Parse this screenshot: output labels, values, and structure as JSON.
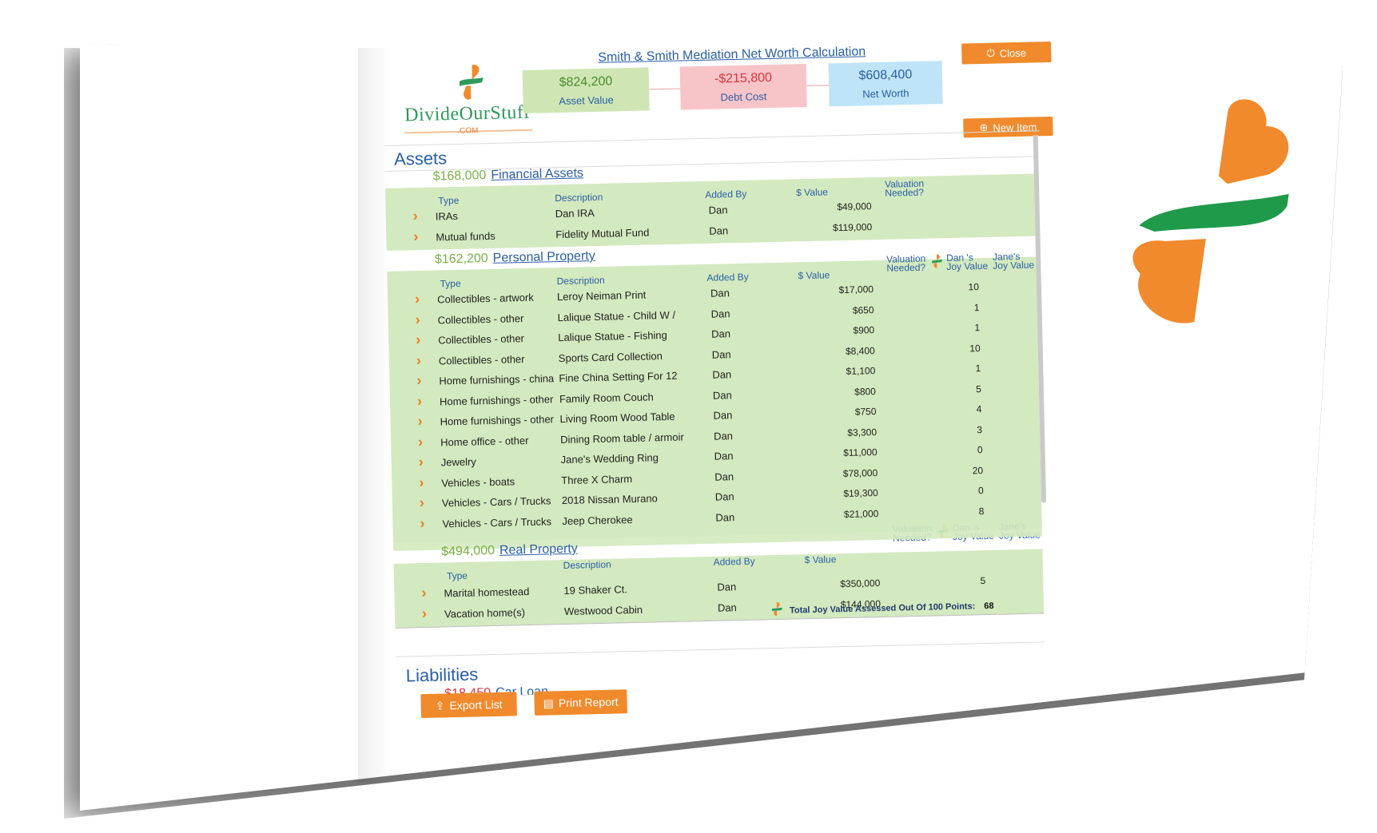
{
  "header": {
    "title": "Smith & Smith Mediation Net Worth Calculation",
    "close_label": "Close",
    "new_item_label": "New Item",
    "logo_text": "DivideOurStuff",
    "logo_com": ".COM"
  },
  "summary": {
    "asset_value": "$824,200",
    "asset_label": "Asset Value",
    "debt_cost": "-$215,800",
    "debt_label": "Debt Cost",
    "net_worth": "$608,400",
    "net_label": "Net Worth"
  },
  "assets": {
    "title": "Assets",
    "financial": {
      "amount": "$168,000",
      "name": "Financial Assets",
      "cols": {
        "type": "Type",
        "description": "Description",
        "added_by": "Added By",
        "value": "$ Value",
        "valuation": "Valuation Needed?"
      },
      "rows": [
        {
          "type": "IRAs",
          "description": "Dan IRA",
          "added_by": "Dan",
          "value": "$49,000"
        },
        {
          "type": "Mutual funds",
          "description": "Fidelity Mutual Fund",
          "added_by": "Dan",
          "value": "$119,000"
        }
      ]
    },
    "personal": {
      "amount": "$162,200",
      "name": "Personal Property",
      "cols": {
        "type": "Type",
        "description": "Description",
        "added_by": "Added By",
        "value": "$ Value",
        "valuation": "Valuation Needed?",
        "dan_joy": "Dan 's Joy Value",
        "jane_joy": "Jane's Joy Value"
      },
      "rows": [
        {
          "type": "Collectibles - artwork",
          "description": "Leroy Neiman Print",
          "added_by": "Dan",
          "value": "$17,000",
          "joy": "10"
        },
        {
          "type": "Collectibles - other",
          "description": "Lalique Statue - Child W /",
          "added_by": "Dan",
          "value": "$650",
          "joy": "1"
        },
        {
          "type": "Collectibles - other",
          "description": "Lalique Statue - Fishing",
          "added_by": "Dan",
          "value": "$900",
          "joy": "1"
        },
        {
          "type": "Collectibles - other",
          "description": "Sports Card Collection",
          "added_by": "Dan",
          "value": "$8,400",
          "joy": "10"
        },
        {
          "type": "Home furnishings - china",
          "description": "Fine China Setting For 12",
          "added_by": "Dan",
          "value": "$1,100",
          "joy": "1"
        },
        {
          "type": "Home furnishings - other",
          "description": "Family Room Couch",
          "added_by": "Dan",
          "value": "$800",
          "joy": "5"
        },
        {
          "type": "Home furnishings - other",
          "description": "Living Room Wood Table",
          "added_by": "Dan",
          "value": "$750",
          "joy": "4"
        },
        {
          "type": "Home office - other",
          "description": "Dining Room table / armoir",
          "added_by": "Dan",
          "value": "$3,300",
          "joy": "3"
        },
        {
          "type": "Jewelry",
          "description": "Jane's Wedding Ring",
          "added_by": "Dan",
          "value": "$11,000",
          "joy": "0"
        },
        {
          "type": "Vehicles - boats",
          "description": "Three X Charm",
          "added_by": "Dan",
          "value": "$78,000",
          "joy": "20"
        },
        {
          "type": "Vehicles - Cars / Trucks",
          "description": "2018 Nissan Murano",
          "added_by": "Dan",
          "value": "$19,300",
          "joy": "0"
        },
        {
          "type": "Vehicles - Cars / Trucks",
          "description": "Jeep Cherokee",
          "added_by": "Dan",
          "value": "$21,000",
          "joy": "8"
        }
      ]
    },
    "real": {
      "amount": "$494,000",
      "name": "Real Property",
      "cols": {
        "type": "Type",
        "description": "Description",
        "added_by": "Added By",
        "value": "$ Value",
        "valuation": "Valuation Needed?",
        "dan_joy": "Dan 's Joy Value",
        "jane_joy": "Jane's Joy Value"
      },
      "rows": [
        {
          "type": "Marital homestead",
          "description": "19 Shaker Ct.",
          "added_by": "Dan",
          "value": "$350,000",
          "joy": "5"
        },
        {
          "type": "Vacation home(s)",
          "description": "Westwood Cabin",
          "added_by": "Dan",
          "value": "$144,000",
          "joy": ""
        }
      ]
    },
    "total_joy_label": "Total Joy Value Assessed Out Of 100 Points:",
    "total_joy_value": "68"
  },
  "liabilities": {
    "title": "Liabilities",
    "partial_amount": "$18,450",
    "partial_name": "Car Loan"
  },
  "footer": {
    "export_label": "Export List",
    "print_label": "Print Report"
  },
  "colors": {
    "accent_orange": "#f08a2c",
    "brand_green": "#2e9a5a",
    "link_blue": "#2a5fa8",
    "row_green": "#d3e9bf"
  }
}
